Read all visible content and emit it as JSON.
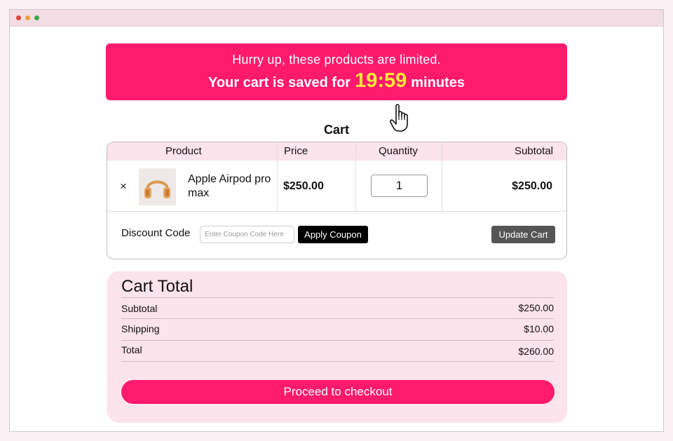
{
  "window": {
    "controls": [
      "close",
      "minimize",
      "maximize"
    ]
  },
  "banner": {
    "line1": "Hurry up, these products are limited.",
    "line2_prefix": "Your cart is saved for",
    "timer": "19:59",
    "line2_suffix": "minutes"
  },
  "cart": {
    "heading": "Cart",
    "columns": {
      "product": "Product",
      "price": "Price",
      "quantity": "Quantity",
      "subtotal": "Subtotal"
    },
    "item": {
      "remove": "×",
      "name": "Apple Airpod pro max",
      "price": "$250.00",
      "quantity": "1",
      "subtotal": "$250.00"
    },
    "discount": {
      "label": "Discount Code",
      "placeholder": "Enter Coupon Code Here",
      "apply_label": "Apply Coupon"
    },
    "update_label": "Update Cart"
  },
  "totals": {
    "title": "Cart Total",
    "subtotal_label": "Subtotal",
    "subtotal_value": "$250.00",
    "shipping_label": "Shipping",
    "shipping_value": "$10.00",
    "total_label": "Total",
    "total_value": "$260.00",
    "checkout_label": "Proceed to checkout"
  },
  "colors": {
    "accent": "#ff1a6b",
    "timer": "#ffe83a",
    "header_bg": "#fde3ec"
  }
}
